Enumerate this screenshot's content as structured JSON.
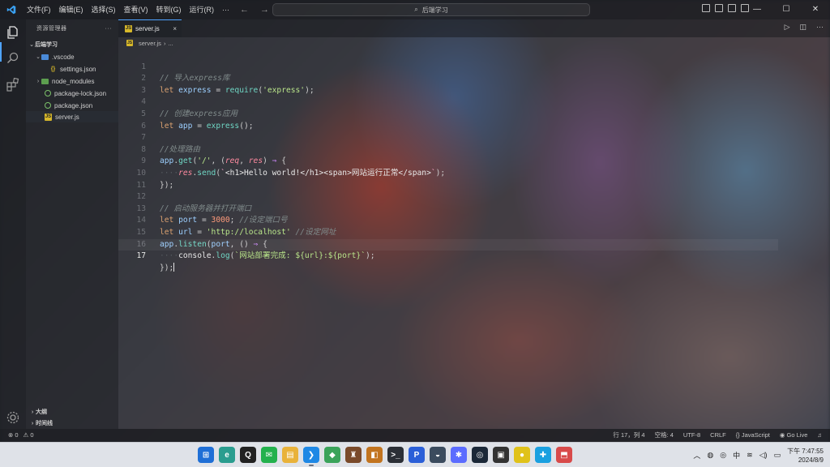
{
  "titlebar": {
    "menu": [
      "文件(F)",
      "编辑(E)",
      "选择(S)",
      "查看(V)",
      "转到(G)",
      "运行(R)",
      "···"
    ],
    "search_text": "后端学习",
    "win_minimize": "—",
    "win_restore": "☐",
    "win_close": "✕"
  },
  "sidebar": {
    "header": "资源管理器",
    "header_more": "···",
    "root": "后端学习",
    "items": [
      {
        "label": ".vscode",
        "icon": "folder-icon",
        "chev": "⌄"
      },
      {
        "label": "settings.json",
        "icon": "json-file-icon"
      },
      {
        "label": "node_modules",
        "icon": "folder-icon",
        "chev": "›"
      },
      {
        "label": "package-lock.json",
        "icon": "npm-file-icon"
      },
      {
        "label": "package.json",
        "icon": "npm-file-icon"
      },
      {
        "label": "server.js",
        "icon": "js-file-icon"
      }
    ],
    "outline": "大纲",
    "timeline": "时间线"
  },
  "editor": {
    "tab_label": "server.js",
    "tab_close": "×",
    "breadcrumb_file": "server.js",
    "breadcrumb_more": "...",
    "js_badge": "JS",
    "line_numbers": [
      "1",
      "2",
      "3",
      "4",
      "5",
      "6",
      "7",
      "8",
      "9",
      "10",
      "11",
      "12",
      "13",
      "14",
      "15",
      "16",
      "17"
    ],
    "active_line": "17",
    "code": {
      "l1_comment": "// 导入express库",
      "l2_kw": "let",
      "l2_var": "express",
      "l2_eq": " = ",
      "l2_fn": "require",
      "l2_str": "'express'",
      "l2_end": ");",
      "l4_comment": "// 创建express应用",
      "l5_kw": "let",
      "l5_var": "app",
      "l5_eq": " = ",
      "l5_fn": "express",
      "l5_end": "();",
      "l7_comment": "//处理路由",
      "l8_obj": "app",
      "l8_fn": "get",
      "l8_str": "'/'",
      "l8_p1": "req",
      "l8_p2": "res",
      "l8_arrow": "⇒",
      "l9_obj": "res",
      "l9_fn": "send",
      "l9_tpl_open": "`",
      "l9_tag1": "<h1>",
      "l9_text1": "Hello world!",
      "l9_tag2": "</h1>",
      "l9_tag3": "<span>",
      "l9_text2": "网站运行正常",
      "l9_tag4": "</span>",
      "l9_tpl_close": "`",
      "l10": "});",
      "l12_comment": "// 启动服务器并打开端口",
      "l13_kw": "let",
      "l13_var": "port",
      "l13_num": "3000",
      "l13_comment": "//设定端口号",
      "l14_kw": "let",
      "l14_var": "url",
      "l14_str": "'http://localhost'",
      "l14_comment": "//设定网址",
      "l15_obj": "app",
      "l15_fn": "listen",
      "l15_p": "port",
      "l15_arrow": "⇒",
      "l16_obj": "console",
      "l16_fn": "log",
      "l16_tpl": "`网站部署完成: ${url}:${port}`",
      "l17": "});"
    }
  },
  "statusbar": {
    "errors": "⊗ 0",
    "warnings": "⚠ 0",
    "position": "行 17，列 4",
    "spaces": "空格: 4",
    "encoding": "UTF-8",
    "eol": "CRLF",
    "language": "{} JavaScript",
    "golive": "Go Live"
  },
  "taskbar": {
    "icons": [
      {
        "name": "windows-start-icon",
        "color": "#1f6fd6",
        "glyph": "⊞"
      },
      {
        "name": "edge-icon",
        "color": "#2a9d8f",
        "glyph": "e"
      },
      {
        "name": "qq-icon",
        "color": "#222222",
        "glyph": "Q"
      },
      {
        "name": "wechat-icon",
        "color": "#23b14d",
        "glyph": "✉"
      },
      {
        "name": "file-explorer-icon",
        "color": "#e9b23a",
        "glyph": "▤"
      },
      {
        "name": "vscode-icon",
        "color": "#1e88e5",
        "glyph": "❯"
      },
      {
        "name": "app-green-icon",
        "color": "#3aa35a",
        "glyph": "◆"
      },
      {
        "name": "game-icon",
        "color": "#7a4a2a",
        "glyph": "♜"
      },
      {
        "name": "app-orange-icon",
        "color": "#c2741f",
        "glyph": "◧"
      },
      {
        "name": "terminal-icon",
        "color": "#2b2f36",
        "glyph": ">_"
      },
      {
        "name": "app-p-icon",
        "color": "#2b5fd8",
        "glyph": "P"
      },
      {
        "name": "app-cat-icon",
        "color": "#3b4b5e",
        "glyph": "◒"
      },
      {
        "name": "app-settings-icon",
        "color": "#5b6cff",
        "glyph": "✱"
      },
      {
        "name": "steam-icon",
        "color": "#1b2838",
        "glyph": "◎"
      },
      {
        "name": "app-dark-icon",
        "color": "#333333",
        "glyph": "▣"
      },
      {
        "name": "app-yellow-icon",
        "color": "#e0c21a",
        "glyph": "●"
      },
      {
        "name": "app-blue-icon",
        "color": "#1aa0e0",
        "glyph": "✚"
      },
      {
        "name": "app-red-icon",
        "color": "#d84a4a",
        "glyph": "⬒"
      }
    ],
    "tray_chevron": "︿",
    "ime": "中",
    "time": "下午 7:47:55",
    "date": "2024/8/9"
  }
}
